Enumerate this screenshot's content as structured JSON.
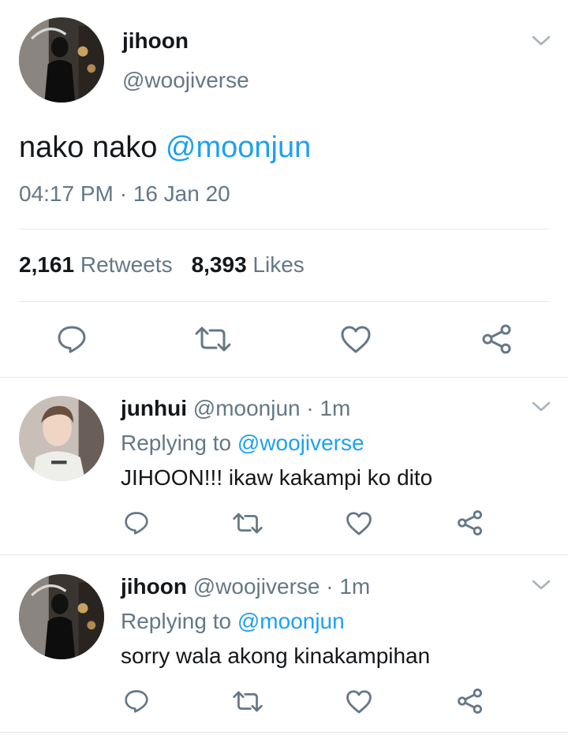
{
  "tweet": {
    "display_name": "jihoon",
    "handle": "@woojiverse",
    "text": "nako nako ",
    "mention": "@moonjun",
    "time": "04:17 PM",
    "separator": " · ",
    "date": "16 Jan 20",
    "retweet_count": "2,161",
    "retweet_label": " Retweets",
    "like_count": "8,393",
    "like_label": " Likes"
  },
  "replies": [
    {
      "display_name": "junhui",
      "handle": " @moonjun",
      "time": " · 1m",
      "replying_prefix": "Replying to ",
      "replying_to": "@woojiverse",
      "text": "JIHOON!!! ikaw kakampi ko dito"
    },
    {
      "display_name": "jihoon",
      "handle": " @woojiverse",
      "time": " · 1m",
      "replying_prefix": "Replying to ",
      "replying_to": "@moonjun",
      "text": "sorry wala akong kinakampihan"
    }
  ],
  "colors": {
    "accent": "#1da1f2",
    "secondary_text": "#657786",
    "primary_text": "#14171a",
    "divider": "#e1e8ed"
  },
  "icons": [
    "reply-icon",
    "retweet-icon",
    "like-icon",
    "share-icon",
    "chevron-down-icon"
  ]
}
